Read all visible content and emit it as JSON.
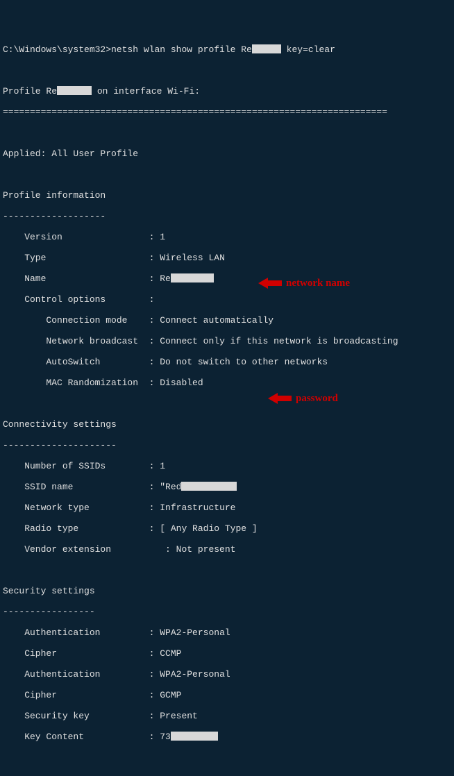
{
  "prompt_line": {
    "path": "C:\\Windows\\system32>",
    "cmd_prefix": "netsh wlan show profile Re",
    "cmd_suffix": " key=clear"
  },
  "profile_header": {
    "prefix": "Profile Re",
    "suffix": " on interface Wi-Fi:"
  },
  "separator": "=======================================================================",
  "applied": "Applied: All User Profile",
  "sections": {
    "profile_info": {
      "title": "Profile information",
      "dash": "-------------------",
      "rows": {
        "version": {
          "k": "    Version                : ",
          "v": "1"
        },
        "type": {
          "k": "    Type                   : ",
          "v": "Wireless LAN"
        },
        "name": {
          "k": "    Name                   : ",
          "v_prefix": "Re"
        },
        "ctrl": {
          "k": "    Control options        :"
        },
        "conn": {
          "k": "        Connection mode    : ",
          "v": "Connect automatically"
        },
        "bcast": {
          "k": "        Network broadcast  : ",
          "v": "Connect only if this network is broadcasting"
        },
        "asw": {
          "k": "        AutoSwitch         : ",
          "v": "Do not switch to other networks"
        },
        "mac": {
          "k": "        MAC Randomization  : ",
          "v": "Disabled"
        }
      }
    },
    "connectivity": {
      "title": "Connectivity settings",
      "dash": "---------------------",
      "rows": {
        "num": {
          "k": "    Number of SSIDs        : ",
          "v": "1"
        },
        "ssid": {
          "k": "    SSID name              : ",
          "v_prefix": "\"Red"
        },
        "ntype": {
          "k": "    Network type           : ",
          "v": "Infrastructure"
        },
        "rtype": {
          "k": "    Radio type             : ",
          "v": "[ Any Radio Type ]"
        },
        "vext": {
          "k": "    Vendor extension          : ",
          "v": "Not present"
        }
      }
    },
    "security": {
      "title": "Security settings",
      "dash": "-----------------",
      "rows": {
        "auth1": {
          "k": "    Authentication         : ",
          "v": "WPA2-Personal"
        },
        "ciph1": {
          "k": "    Cipher                 : ",
          "v": "CCMP"
        },
        "auth2": {
          "k": "    Authentication         : ",
          "v": "WPA2-Personal"
        },
        "ciph2": {
          "k": "    Cipher                 : ",
          "v": "GCMP"
        },
        "skey": {
          "k": "    Security key           : ",
          "v": "Present"
        },
        "kcont": {
          "k": "    Key Content            : ",
          "v_prefix": "73"
        }
      }
    }
  },
  "annotations": {
    "ssid": "network name",
    "key": "password"
  }
}
